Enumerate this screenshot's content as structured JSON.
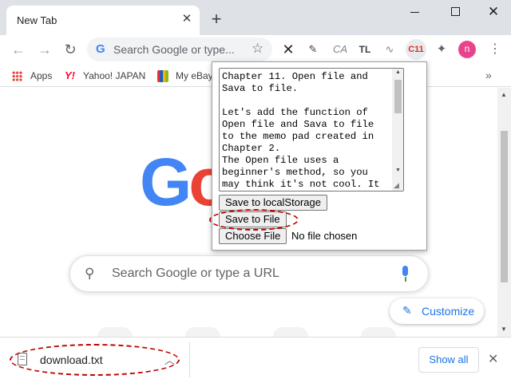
{
  "window": {
    "tab_title": "New Tab",
    "tab_close": "✕",
    "new_tab": "+",
    "close": "✕"
  },
  "toolbar": {
    "back": "←",
    "forward": "→",
    "reload": "↻",
    "omnibox_g": "G",
    "omnibox_placeholder": "Search Google or type...",
    "star": "☆",
    "extensions": {
      "cross": "✕",
      "edit": "✎",
      "ca": "CA",
      "tl": "TL",
      "wave": "∿",
      "c11": "C11",
      "puzzle": "✦"
    },
    "avatar_letter": "n",
    "menu": "⋮"
  },
  "bookmarks": {
    "items": [
      {
        "label": "Apps"
      },
      {
        "label": "Yahoo! JAPAN",
        "mark": "Y!"
      },
      {
        "label": "My eBay"
      }
    ],
    "more": "»"
  },
  "newtab": {
    "logo_letters": [
      "G",
      "o"
    ],
    "search_placeholder": "Search Google or type a URL",
    "search_icon": "⚲",
    "customize_label": "Customize",
    "customize_icon": "✎"
  },
  "popup": {
    "memo_text": "Chapter 11. Open file and\nSava to file.\n\nLet's add the function of\nOpen file and Sava to file\nto the memo pad created in\nChapter 2.\nThe Open file uses a\nbeginner's method, so you\nmay think it's not cool. It",
    "save_storage_label": "Save to localStorage",
    "save_file_label": "Save to File",
    "choose_file_label": "Choose File",
    "no_file_text": "No file chosen",
    "scroll_up": "▲",
    "scroll_down": "▼",
    "grip": "◢"
  },
  "downloads": {
    "filename": "download.txt",
    "chevron": "︿",
    "show_all_label": "Show all",
    "close": "✕"
  },
  "scrollbar": {
    "up": "▲",
    "down": "▼"
  }
}
